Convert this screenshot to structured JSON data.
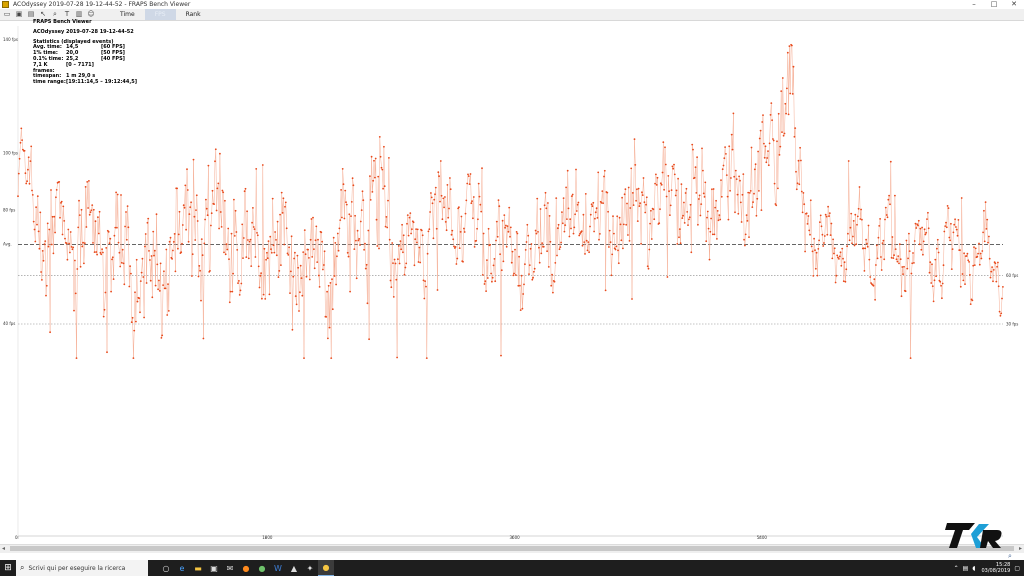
{
  "window": {
    "title": "ACOdyssey 2019-07-28 19-12-44-52 - FRAPS Bench Viewer",
    "minimize": "–",
    "maximize": "□",
    "close": "✕"
  },
  "toolbar": {
    "tools": [
      "open-folder-icon",
      "save-icon",
      "save-all-icon",
      "cursor-icon",
      "zoom-icon",
      "text-icon",
      "bar-chart-icon",
      "person-icon"
    ],
    "tabs": [
      {
        "label": "Time",
        "active": false
      },
      {
        "label": "FPS",
        "active": true
      },
      {
        "label": "Rank",
        "active": false
      }
    ]
  },
  "stats": {
    "app_name": "FRAPS Bench Viewer",
    "file": "ACOdyssey 2019-07-28 19-12-44-52",
    "heading": "Statistics (displayed events)",
    "rows": [
      {
        "k": "Avg. time:",
        "v": "14,5",
        "f": "[60 FPS]"
      },
      {
        "k": "1% time:",
        "v": "20,0",
        "f": "[50 FPS]"
      },
      {
        "k": "0.1% time:",
        "v": "25,2",
        "f": "[40 FPS]"
      },
      {
        "k": "7,1 K frames:",
        "v": "[0 – 7171]",
        "f": ""
      },
      {
        "k": "timespan:",
        "v": "1 m 29,0 s",
        "f": ""
      },
      {
        "k": "time range:",
        "v": "[19:11:14,5 – 19:12:44,5]",
        "f": ""
      }
    ]
  },
  "chart_data": {
    "type": "scatter",
    "y_ticks": [
      "140 fps",
      "100 fps",
      "Avg.",
      "80 fps",
      "40 fps"
    ],
    "x_ticks": [
      "0",
      "1800",
      "3600",
      "5400"
    ],
    "ref_lines": [
      {
        "label": "Avg.",
        "style": "dashed",
        "fps": 68
      },
      {
        "label": "60 fps",
        "style": "dotted",
        "fps": 57
      },
      {
        "label": "30 fps",
        "style": "dotted",
        "fps": 40
      }
    ],
    "y_axis_fps": [
      140,
      100,
      80,
      40
    ],
    "ylim": [
      0,
      140
    ],
    "series_color": "#e8491b",
    "segments": [
      {
        "x0": 0,
        "x1": 150,
        "y0": 95,
        "y1": 80,
        "noise": 10
      },
      {
        "x0": 150,
        "x1": 700,
        "y0": 72,
        "y1": 68,
        "noise": 12
      },
      {
        "x0": 700,
        "x1": 1100,
        "y0": 68,
        "y1": 50,
        "noise": 16
      },
      {
        "x0": 1100,
        "x1": 1450,
        "y0": 70,
        "y1": 75,
        "noise": 14
      },
      {
        "x0": 1450,
        "x1": 1800,
        "y0": 72,
        "y1": 65,
        "noise": 14
      },
      {
        "x0": 1800,
        "x1": 2300,
        "y0": 70,
        "y1": 58,
        "noise": 14
      },
      {
        "x0": 2300,
        "x1": 2700,
        "y0": 66,
        "y1": 92,
        "noise": 12
      },
      {
        "x0": 2700,
        "x1": 3000,
        "y0": 64,
        "y1": 70,
        "noise": 10
      },
      {
        "x0": 3000,
        "x1": 3400,
        "y0": 80,
        "y1": 72,
        "noise": 10
      },
      {
        "x0": 3400,
        "x1": 3800,
        "y0": 68,
        "y1": 62,
        "noise": 10
      },
      {
        "x0": 3800,
        "x1": 4200,
        "y0": 72,
        "y1": 78,
        "noise": 12
      },
      {
        "x0": 4200,
        "x1": 4800,
        "y0": 76,
        "y1": 84,
        "noise": 12
      },
      {
        "x0": 4800,
        "x1": 5400,
        "y0": 82,
        "y1": 88,
        "noise": 12
      },
      {
        "x0": 5400,
        "x1": 5650,
        "y0": 95,
        "y1": 125,
        "noise": 14
      },
      {
        "x0": 5650,
        "x1": 5850,
        "y0": 100,
        "y1": 60,
        "noise": 10
      },
      {
        "x0": 5850,
        "x1": 6200,
        "y0": 70,
        "y1": 68,
        "noise": 8
      },
      {
        "x0": 6200,
        "x1": 6700,
        "y0": 67,
        "y1": 66,
        "noise": 8
      },
      {
        "x0": 6700,
        "x1": 7171,
        "y0": 66,
        "y1": 62,
        "noise": 8
      }
    ]
  },
  "hscroll": {
    "left": "◂",
    "right": "▸"
  },
  "taskbar": {
    "start_icon": "windows-icon",
    "search_placeholder": "Scrivi qui per eseguire la ricerca",
    "apps": [
      "task-view-icon",
      "edge-icon",
      "file-explorer-icon",
      "store-icon",
      "mail-icon",
      "firefox-icon",
      "chrome-icon",
      "word-icon",
      "photos-icon",
      "steam-icon",
      "fraps-icon"
    ],
    "time": "15:28",
    "date": "03/08/2019"
  },
  "logo": {
    "text": "TKR"
  }
}
